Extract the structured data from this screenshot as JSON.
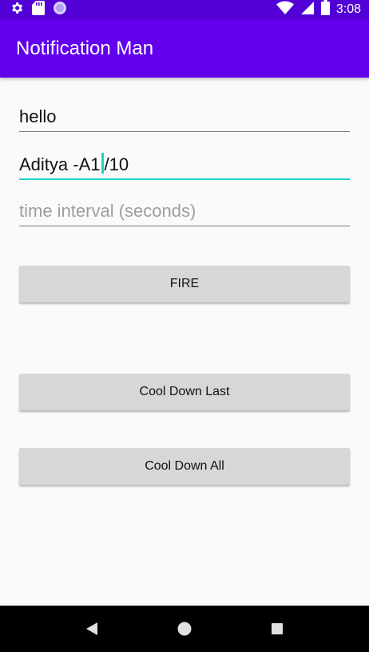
{
  "status_bar": {
    "time": "3:08",
    "icons_left": [
      "gear-icon",
      "sd-card-icon",
      "circle-icon"
    ],
    "icons_right": [
      "wifi-icon",
      "cell-signal-icon",
      "battery-icon"
    ]
  },
  "app_bar": {
    "title": "Notification Man",
    "color": "#6200ee"
  },
  "form": {
    "title_value": "hello",
    "content_value_before_cursor": "Aditya -A1",
    "content_value_after_cursor": "/10",
    "interval_placeholder": "time interval (seconds)",
    "accent_color": "#18d6c5"
  },
  "buttons": {
    "fire": "FIRE",
    "cool_down_last": "Cool Down Last",
    "cool_down_all": "Cool Down All"
  },
  "nav_bar": {
    "items": [
      "back-icon",
      "home-icon",
      "recents-icon"
    ]
  }
}
